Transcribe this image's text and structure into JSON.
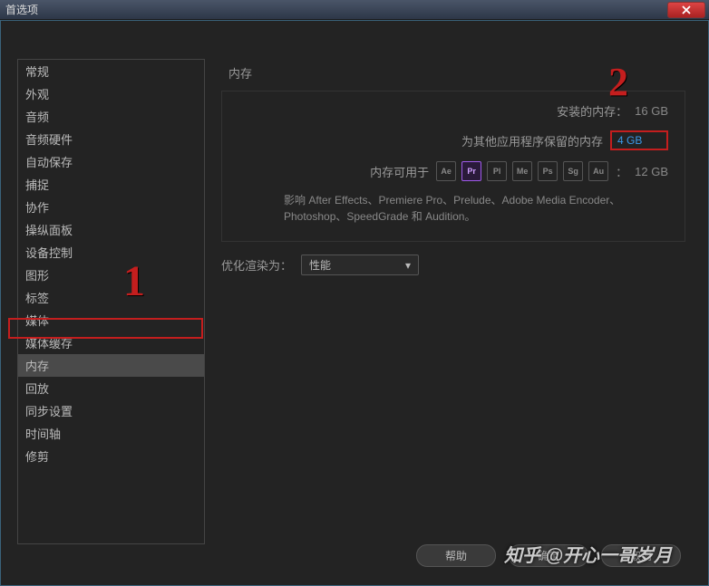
{
  "window": {
    "title": "首选项"
  },
  "sidebar": {
    "items": [
      {
        "label": "常规"
      },
      {
        "label": "外观"
      },
      {
        "label": "音频"
      },
      {
        "label": "音频硬件"
      },
      {
        "label": "自动保存"
      },
      {
        "label": "捕捉"
      },
      {
        "label": "协作"
      },
      {
        "label": "操纵面板"
      },
      {
        "label": "设备控制"
      },
      {
        "label": "图形"
      },
      {
        "label": "标签"
      },
      {
        "label": "媒体"
      },
      {
        "label": "媒体缓存"
      },
      {
        "label": "内存",
        "selected": true
      },
      {
        "label": "回放"
      },
      {
        "label": "同步设置"
      },
      {
        "label": "时间轴"
      },
      {
        "label": "修剪"
      }
    ]
  },
  "main": {
    "section_title": "内存",
    "installed_label": "安装的内存：",
    "installed_value": "16 GB",
    "reserved_label": "为其他应用程序保留的内存",
    "reserved_value": "4 GB",
    "available_label": "内存可用于",
    "available_value": "12 GB",
    "available_colon": "：",
    "apps": [
      "Ae",
      "Pr",
      "Pl",
      "Me",
      "Ps",
      "Sg",
      "Au"
    ],
    "apps_active_index": 1,
    "affects_text": "影响 After Effects、Premiere Pro、Prelude、Adobe Media Encoder、Photoshop、SpeedGrade 和 Audition。",
    "optimize_label": "优化渲染为：",
    "optimize_value": "性能"
  },
  "footer": {
    "help": "帮助",
    "ok": "确定",
    "cancel": "取消"
  },
  "annotations": {
    "one": "1",
    "two": "2"
  },
  "watermark": "知乎 @开心一哥岁月"
}
